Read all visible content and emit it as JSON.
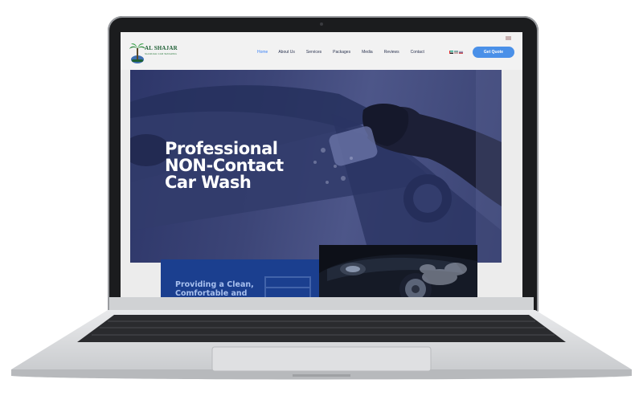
{
  "site": {
    "logo_title": "AL SHAJAR",
    "logo_subtitle": "SHARJAH CAR WASHING"
  },
  "nav": {
    "items": [
      {
        "label": "Home",
        "active": true
      },
      {
        "label": "About Us",
        "active": false
      },
      {
        "label": "Services",
        "active": false
      },
      {
        "label": "Packages",
        "active": false
      },
      {
        "label": "Media",
        "active": false
      },
      {
        "label": "Reviews",
        "active": false
      },
      {
        "label": "Contact",
        "active": false
      }
    ],
    "cta_label": "Get Quote"
  },
  "hero": {
    "title_line1": "Professional",
    "title_line2": "NON-Contact",
    "title_line3": "Car Wash"
  },
  "intro": {
    "line1": "Providing a Clean,",
    "line2": "Comfortable and"
  },
  "colors": {
    "accent": "#4a90e8",
    "nav_text": "#2b3450",
    "hero_overlay": "#3c4577",
    "intro_box": "#1b3f8f",
    "logo_green": "#1d5f33"
  }
}
